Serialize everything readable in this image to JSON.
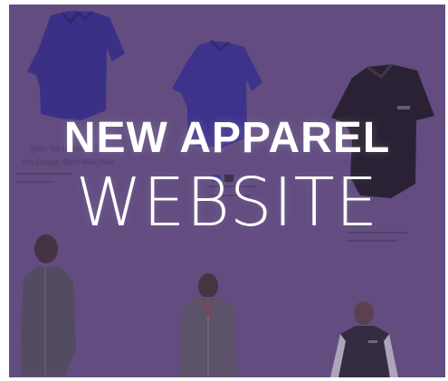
{
  "banner": {
    "line1": "NEW APPAREL",
    "line2": "WEBSITE"
  },
  "background": {
    "product_captions": [
      "Sport-Tek Ladies",
      "Pro Charge Sport-Wick Polo"
    ],
    "colors": {
      "overlay": "#5c4478",
      "text": "#ffffff",
      "polo_blue": "#2e2ea8",
      "polo_black": "#111111",
      "model_grey": "#5c5b62"
    },
    "icons": [
      "blue-polo-image",
      "black-polo-image",
      "model-jacket-image",
      "model-quarter-zip-image",
      "model-vest-image"
    ]
  }
}
